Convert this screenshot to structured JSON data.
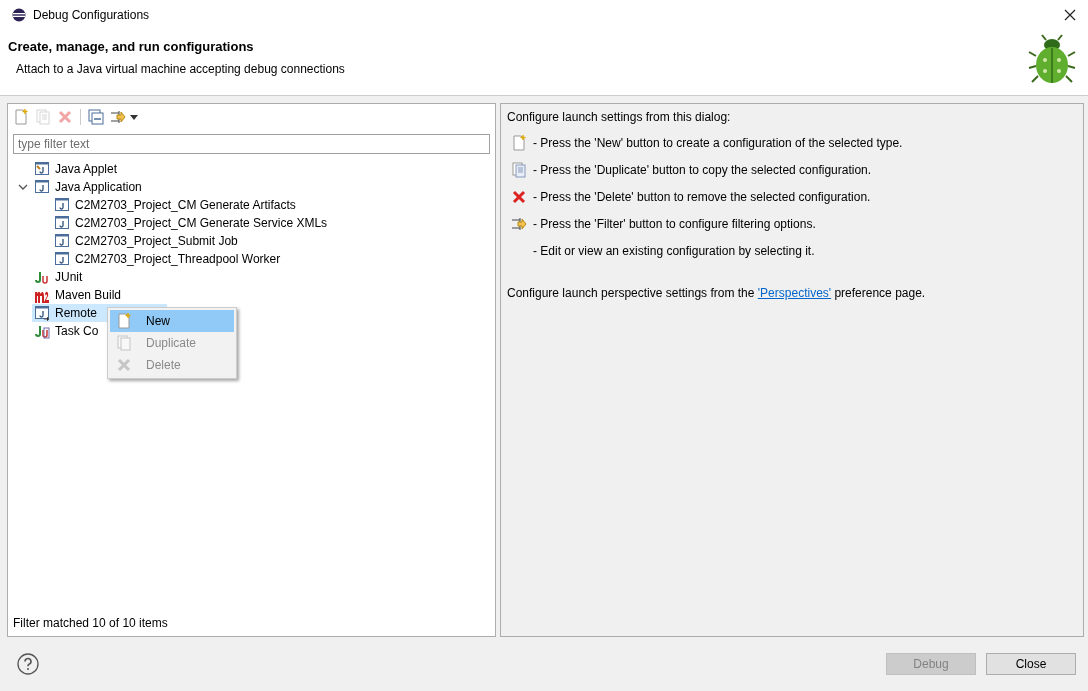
{
  "window": {
    "title": "Debug Configurations"
  },
  "header": {
    "title": "Create, manage, and run configurations",
    "subtitle": "Attach to a Java virtual machine accepting debug connections"
  },
  "toolbar": [
    {
      "kind": "new",
      "disabled": false
    },
    {
      "kind": "duplicate",
      "disabled": true
    },
    {
      "kind": "delete",
      "disabled": true
    },
    {
      "kind": "collapse",
      "disabled": false
    },
    {
      "kind": "filter",
      "disabled": false
    }
  ],
  "filter": {
    "placeholder": "type filter text"
  },
  "tree": [
    {
      "label": "Java Applet",
      "kind": "applet",
      "selected": false
    },
    {
      "label": "Java Application",
      "kind": "application",
      "selected": false,
      "expanded": true,
      "children": [
        {
          "label": "C2M2703_Project_CM Generate Artifacts",
          "kind": "application",
          "selected": false
        },
        {
          "label": "C2M2703_Project_CM Generate Service XMLs",
          "kind": "application",
          "selected": false
        },
        {
          "label": "C2M2703_Project_Submit Job",
          "kind": "application",
          "selected": false
        },
        {
          "label": "C2M2703_Project_Threadpool Worker",
          "kind": "application",
          "selected": false
        }
      ]
    },
    {
      "label": "JUnit",
      "kind": "junit",
      "selected": false
    },
    {
      "label": "Maven Build",
      "kind": "maven",
      "selected": false
    },
    {
      "label": "Remote",
      "kind": "remote",
      "selected": true
    },
    {
      "label": "Task Co",
      "kind": "task",
      "selected": false
    }
  ],
  "context_menu": [
    {
      "label": "New",
      "kind": "new",
      "selected": true,
      "disabled": false
    },
    {
      "label": "Duplicate",
      "kind": "duplicate",
      "selected": false,
      "disabled": true
    },
    {
      "label": "Delete",
      "kind": "delete",
      "selected": false,
      "disabled": true
    }
  ],
  "filter_status": "Filter matched 10 of 10 items",
  "info": {
    "heading": "Configure launch settings from this dialog:",
    "lines": [
      {
        "kind": "new",
        "text": "- Press the 'New' button to create a configuration of the selected type."
      },
      {
        "kind": "duplicate",
        "text": "- Press the 'Duplicate' button to copy the selected configuration."
      },
      {
        "kind": "delete",
        "text": "- Press the 'Delete' button to remove the selected configuration."
      },
      {
        "kind": "filter",
        "text": "- Press the 'Filter' button to configure filtering options."
      },
      {
        "kind": "plain",
        "text": "- Edit or view an existing configuration by selecting it."
      }
    ],
    "perspective": {
      "before": "Configure launch perspective settings from the ",
      "link": "'Perspectives'",
      "after": " preference page."
    }
  },
  "buttons": [
    {
      "label": "Debug",
      "disabled": true
    },
    {
      "label": "Close",
      "disabled": false
    }
  ]
}
